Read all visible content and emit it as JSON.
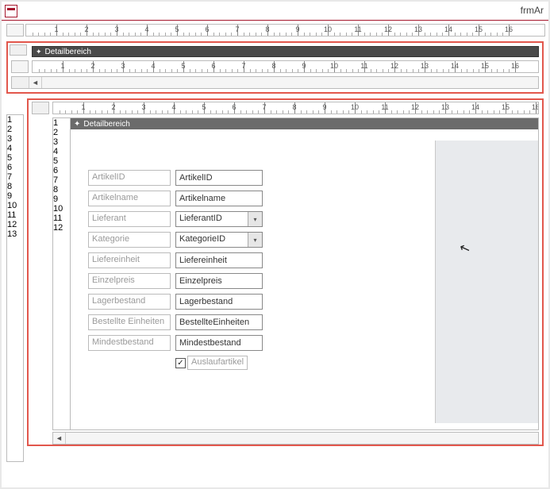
{
  "window": {
    "title": "frmAr"
  },
  "sections": {
    "detail_main": "Detailbereich",
    "detail_sub": "Detailbereich"
  },
  "fields": [
    {
      "label": "ArtikelID",
      "control": "ArtikelID",
      "type": "text"
    },
    {
      "label": "Artikelname",
      "control": "Artikelname",
      "type": "text"
    },
    {
      "label": "Lieferant",
      "control": "LieferantID",
      "type": "combo"
    },
    {
      "label": "Kategorie",
      "control": "KategorieID",
      "type": "combo"
    },
    {
      "label": "Liefereinheit",
      "control": "Liefereinheit",
      "type": "text"
    },
    {
      "label": "Einzelpreis",
      "control": "Einzelpreis",
      "type": "text"
    },
    {
      "label": "Lagerbestand",
      "control": "Lagerbestand",
      "type": "text"
    },
    {
      "label": "Bestellte Einheiten",
      "control": "BestellteEinheiten",
      "type": "text"
    },
    {
      "label": "Mindestbestand",
      "control": "Mindestbestand",
      "type": "text"
    }
  ],
  "checkbox": {
    "label": "Auslaufartikel",
    "checked": true
  },
  "ruler_units": [
    1,
    2,
    3,
    4,
    5,
    6,
    7,
    8,
    9,
    10,
    11,
    12,
    13,
    14,
    15,
    16
  ]
}
